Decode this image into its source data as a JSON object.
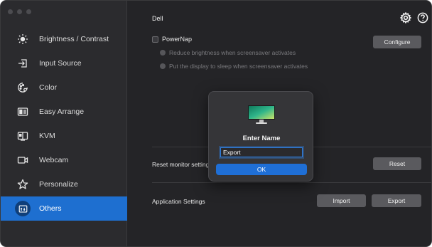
{
  "sidebar": {
    "items": [
      {
        "label": "Brightness / Contrast",
        "icon": "brightness-icon"
      },
      {
        "label": "Input Source",
        "icon": "input-source-icon"
      },
      {
        "label": "Color",
        "icon": "color-icon"
      },
      {
        "label": "Easy Arrange",
        "icon": "easy-arrange-icon"
      },
      {
        "label": "KVM",
        "icon": "kvm-icon"
      },
      {
        "label": "Webcam",
        "icon": "webcam-icon"
      },
      {
        "label": "Personalize",
        "icon": "star-icon"
      },
      {
        "label": "Others",
        "icon": "others-icon",
        "active": true
      }
    ]
  },
  "header": {
    "title": "Dell"
  },
  "powernap": {
    "label": "PowerNap",
    "option1": "Reduce brightness when screensaver activates",
    "option2": "Put the display to sleep when screensaver activates",
    "configure_label": "Configure"
  },
  "reset": {
    "label": "Reset monitor settings",
    "button": "Reset"
  },
  "app_settings": {
    "label": "Application Settings",
    "import_button": "Import",
    "export_button": "Export"
  },
  "modal": {
    "title": "Enter Name",
    "input_value": "Export",
    "ok_label": "OK"
  },
  "colors": {
    "accent": "#1e6fd0",
    "background": "#242427",
    "sidebar": "#2b2b2e"
  }
}
